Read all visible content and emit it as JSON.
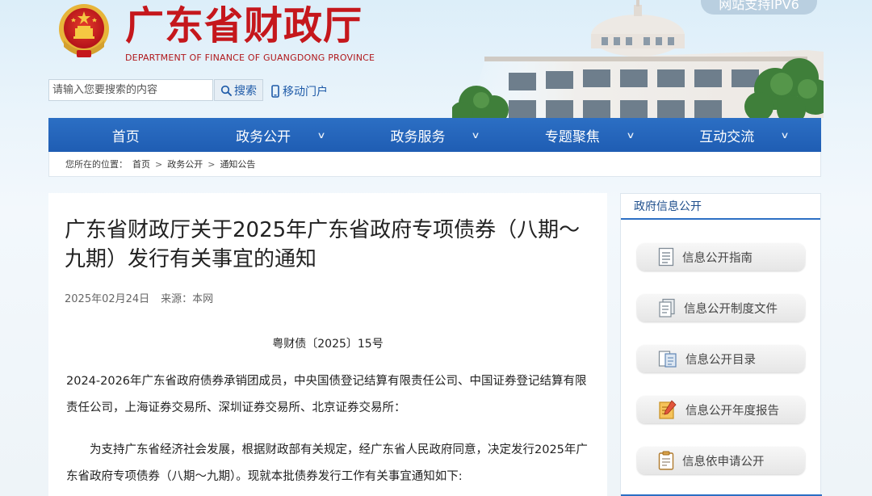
{
  "header": {
    "title_cn": "广东省财政厅",
    "title_en": "DEPARTMENT OF FINANCE OF GUANGDONG PROVINCE",
    "ipv6_badge": "网站支持IPV6",
    "emblem_icon": "national-emblem-icon"
  },
  "search": {
    "placeholder": "请输入您要搜索的内容",
    "button_label": "搜索",
    "button_icon": "search-icon"
  },
  "mobile": {
    "label": "移动门户",
    "icon": "mobile-phone-icon"
  },
  "nav": {
    "items": [
      {
        "label": "首页",
        "has_dropdown": false
      },
      {
        "label": "政务公开",
        "has_dropdown": true
      },
      {
        "label": "政务服务",
        "has_dropdown": true
      },
      {
        "label": "专题聚焦",
        "has_dropdown": true
      },
      {
        "label": "互动交流",
        "has_dropdown": true
      }
    ],
    "chevron": "∨"
  },
  "breadcrumb": {
    "prefix": "您所在的位置：",
    "items": [
      "首页",
      "政务公开",
      "通知公告"
    ],
    "separator": ">"
  },
  "article": {
    "title": "广东省财政厅关于2025年广东省政府专项债券（八期～九期）发行有关事宜的通知",
    "date": "2025年02月24日",
    "source": "来源：本网",
    "doc_number": "粤财债〔2025〕15号",
    "paragraph1": "2024-2026年广东省政府债券承销团成员，中央国债登记结算有限责任公司、中国证券登记结算有限责任公司，上海证券交易所、深圳证券交易所、北京证券交易所：",
    "paragraph2": "为支持广东省经济社会发展，根据财政部有关规定，经广东省人民政府同意，决定发行2025年广东省政府专项债券（八期～九期）。现就本批债券发行工作有关事宜通知如下:"
  },
  "sidebar": {
    "header": "政府信息公开",
    "items": [
      {
        "label": "信息公开指南",
        "icon": "document-guide-icon"
      },
      {
        "label": "信息公开制度文件",
        "icon": "document-stack-icon"
      },
      {
        "label": "信息公开目录",
        "icon": "catalog-icon"
      },
      {
        "label": "信息公开年度报告",
        "icon": "annual-report-icon"
      },
      {
        "label": "信息依申请公开",
        "icon": "clipboard-icon"
      }
    ]
  },
  "colors": {
    "brand_red": "#c5171c",
    "nav_blue": "#2c6fc4",
    "link_blue": "#1e5aa8"
  }
}
